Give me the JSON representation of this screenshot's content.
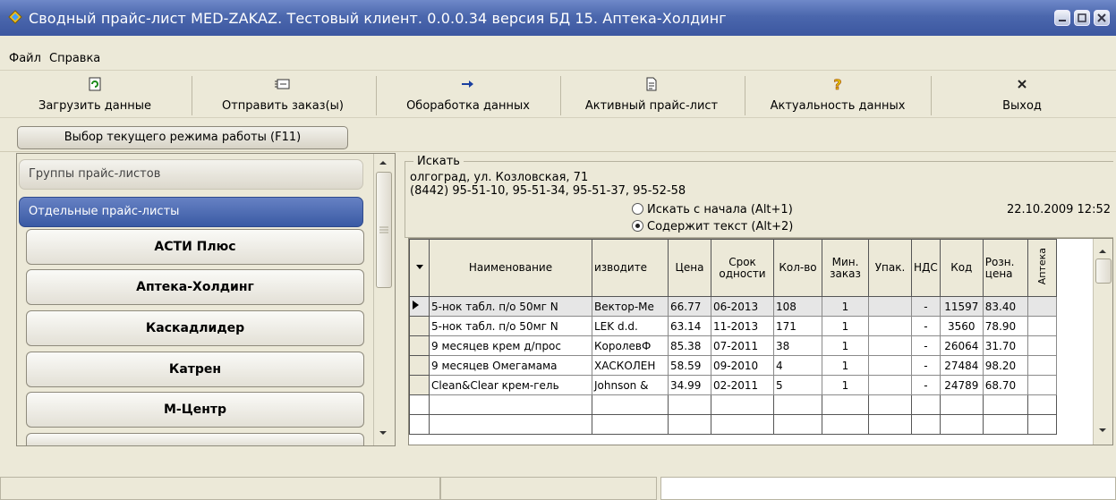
{
  "window": {
    "title": "Сводный прайс-лист MED-ZAKAZ. Тестовый клиент. 0.0.0.34 версия БД 15. Аптека-Холдинг"
  },
  "menu": {
    "items": [
      "Файл",
      "Справка"
    ]
  },
  "toolbar": {
    "load": "Загрузить данные",
    "send": "Отправить заказ(ы)",
    "process": "Обоработка данных",
    "active": "Активный прайс-лист",
    "actuality": "Актуальность данных",
    "exit": "Выход"
  },
  "mode_button": "Выбор текущего режима работы (F11)",
  "left": {
    "groups_header": "Группы прайс-листов",
    "separate_header": "Отдельные прайс-листы",
    "vendors": [
      "АСТИ Плюс",
      "Аптека-Холдинг",
      "Каскадлидер",
      "Катрен",
      "М-Центр"
    ]
  },
  "search": {
    "legend": "Искать",
    "address": "олгоград, ул. Козловская, 71",
    "phones": "(8442) 95-51-10, 95-51-34, 95-51-37, 95-52-58",
    "datetime": "22.10.2009 12:52",
    "option_start": "Искать с начала (Alt+1)",
    "option_contains": "Содержит текст (Alt+2)"
  },
  "grid": {
    "headers": [
      "Наименование",
      "изводите",
      "Цена",
      "Срок одности",
      "Кол-во",
      "Мин. заказ",
      "Упак.",
      "НДС",
      "Код",
      "Розн. цена",
      "Аптека"
    ],
    "rows": [
      [
        "5-нок табл. п/о 50мг N",
        "Вектор-Ме",
        "66.77",
        "06-2013",
        "108",
        "1",
        "",
        "-",
        "11597",
        "83.40",
        ""
      ],
      [
        "5-нок табл. п/о 50мг N",
        "LEK d.d.",
        "63.14",
        "11-2013",
        "171",
        "1",
        "",
        "-",
        "3560",
        "78.90",
        ""
      ],
      [
        "9 месяцев крем д/прос",
        "КоролевФ",
        "85.38",
        "07-2011",
        "38",
        "1",
        "",
        "-",
        "26064",
        "31.70",
        ""
      ],
      [
        "9 месяцев Омегамама",
        "ХАСКОЛЕН",
        "58.59",
        "09-2010",
        "4",
        "1",
        "",
        "-",
        "27484",
        "98.20",
        ""
      ],
      [
        "Clean&Clear крем-гель",
        "Johnson &",
        "34.99",
        "02-2011",
        "5",
        "1",
        "",
        "-",
        "24789",
        "68.70",
        ""
      ]
    ]
  },
  "colors": {
    "title_bar": "#4b67ad",
    "active_group": "#3a5aa4",
    "window_bg": "#ece9d8"
  }
}
